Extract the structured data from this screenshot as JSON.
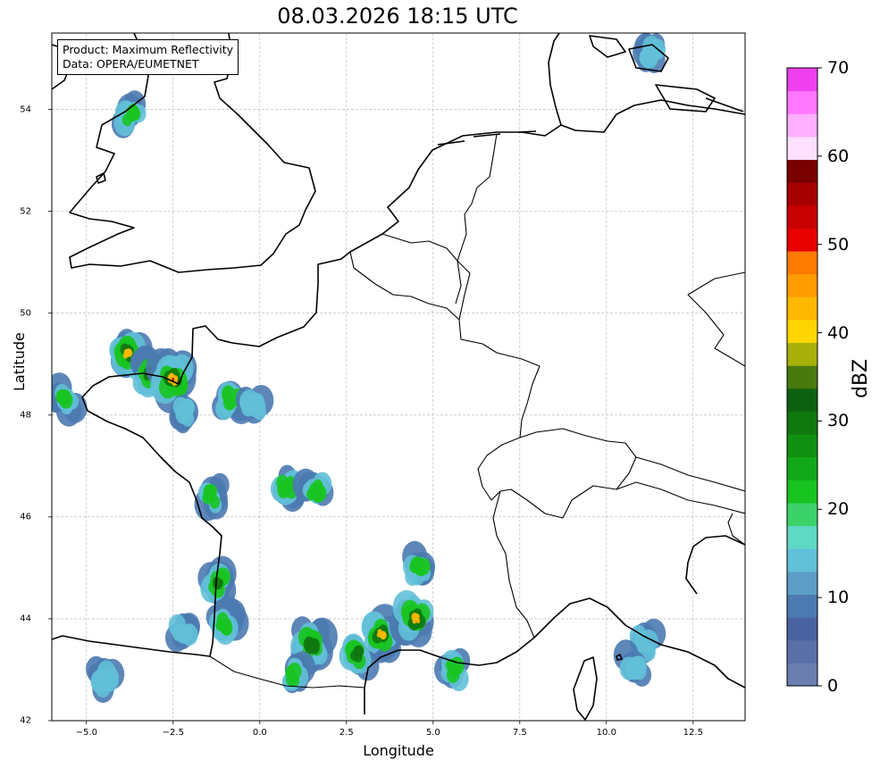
{
  "title": "08.03.2026 18:15 UTC",
  "info": {
    "line1": "Product: Maximum Reflectivity",
    "line2": "Data: OPERA/EUMETNET"
  },
  "axes": {
    "xlabel": "Longitude",
    "ylabel": "Latitude",
    "xlim": [
      -6,
      14
    ],
    "ylim": [
      42,
      55.5
    ],
    "xticks": [
      "−5.0",
      "−2.5",
      "0.0",
      "2.5",
      "5.0",
      "7.5",
      "10.0",
      "12.5"
    ],
    "xtick_values": [
      -5,
      -2.5,
      0,
      2.5,
      5,
      7.5,
      10,
      12.5
    ],
    "yticks": [
      "42",
      "44",
      "46",
      "48",
      "50",
      "52",
      "54"
    ],
    "ytick_values": [
      42,
      44,
      46,
      48,
      50,
      52,
      54
    ],
    "grid": true
  },
  "colorbar": {
    "label": "dBZ",
    "ticks": [
      "0",
      "10",
      "20",
      "30",
      "40",
      "50",
      "60",
      "70"
    ],
    "tick_values": [
      0,
      10,
      20,
      30,
      40,
      50,
      60,
      70
    ],
    "colors": [
      "#6a7fb0",
      "#5a70a8",
      "#4a62a0",
      "#4b7ab0",
      "#5c9ec8",
      "#62c0d8",
      "#5fd8c4",
      "#3cd26a",
      "#18c420",
      "#12a81a",
      "#109010",
      "#10780e",
      "#0d6010",
      "#487a10",
      "#a8b00c",
      "#ffd600",
      "#ffb800",
      "#ff9c00",
      "#ff7a00",
      "#e60000",
      "#c80000",
      "#a80000",
      "#7a0000",
      "#ffe0ff",
      "#ffb0ff",
      "#ff78ff",
      "#ee40ee"
    ]
  },
  "chart_data": {
    "type": "heatmap",
    "title": "08.03.2026 18:15 UTC",
    "xlabel": "Longitude",
    "ylabel": "Latitude",
    "xlim": [
      -6,
      14
    ],
    "ylim": [
      42,
      55.5
    ],
    "colorbar_label": "dBZ",
    "colorbar_range": [
      0,
      70
    ],
    "precip_cells": [
      {
        "lon": -3.7,
        "lat": 53.9,
        "max_dbz": 25
      },
      {
        "lon": -3.8,
        "lat": 49.2,
        "max_dbz": 42
      },
      {
        "lon": -3.2,
        "lat": 48.8,
        "max_dbz": 30
      },
      {
        "lon": -2.5,
        "lat": 48.7,
        "max_dbz": 55
      },
      {
        "lon": -5.6,
        "lat": 48.3,
        "max_dbz": 22
      },
      {
        "lon": -2.2,
        "lat": 48.0,
        "max_dbz": 20
      },
      {
        "lon": -0.8,
        "lat": 48.3,
        "max_dbz": 25
      },
      {
        "lon": -0.2,
        "lat": 48.2,
        "max_dbz": 20
      },
      {
        "lon": -1.4,
        "lat": 46.4,
        "max_dbz": 22
      },
      {
        "lon": 0.8,
        "lat": 46.6,
        "max_dbz": 25
      },
      {
        "lon": 1.6,
        "lat": 46.5,
        "max_dbz": 22
      },
      {
        "lon": -1.2,
        "lat": 44.7,
        "max_dbz": 30
      },
      {
        "lon": -1.0,
        "lat": 43.9,
        "max_dbz": 25
      },
      {
        "lon": -2.2,
        "lat": 43.8,
        "max_dbz": 15
      },
      {
        "lon": -4.5,
        "lat": 42.8,
        "max_dbz": 18
      },
      {
        "lon": 1.5,
        "lat": 43.5,
        "max_dbz": 40
      },
      {
        "lon": 1.0,
        "lat": 42.9,
        "max_dbz": 22
      },
      {
        "lon": 3.5,
        "lat": 43.7,
        "max_dbz": 42
      },
      {
        "lon": 4.5,
        "lat": 44.0,
        "max_dbz": 45
      },
      {
        "lon": 4.6,
        "lat": 45.0,
        "max_dbz": 22
      },
      {
        "lon": 5.6,
        "lat": 43.0,
        "max_dbz": 25
      },
      {
        "lon": 2.8,
        "lat": 43.3,
        "max_dbz": 30
      },
      {
        "lon": 11.1,
        "lat": 43.5,
        "max_dbz": 20
      },
      {
        "lon": 10.8,
        "lat": 43.1,
        "max_dbz": 18
      },
      {
        "lon": 11.3,
        "lat": 55.1,
        "max_dbz": 15
      }
    ]
  }
}
